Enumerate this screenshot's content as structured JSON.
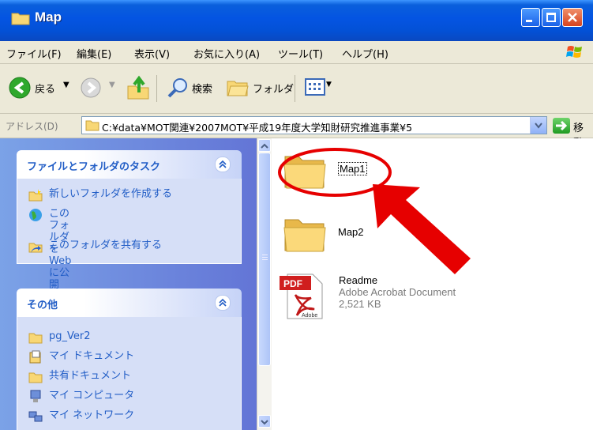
{
  "window": {
    "title": "Map"
  },
  "menu": {
    "items": [
      "ファイル(F)",
      "編集(E)",
      "表示(V)",
      "お気に入り(A)",
      "ツール(T)",
      "ヘルプ(H)"
    ]
  },
  "toolbar": {
    "back": "戻る",
    "search": "検索",
    "folders": "フォルダ"
  },
  "address": {
    "label": "アドレス(D)",
    "path": "C:¥data¥MOT関連¥2007MOT¥平成19年度大学知財研究推進事業¥5",
    "go": "移動"
  },
  "tasks_panel": {
    "title": "ファイルとフォルダのタスク",
    "items": [
      "新しいフォルダを作成する",
      "このフォルダを Web に公開\nする",
      "このフォルダを共有する"
    ]
  },
  "other_panel": {
    "title": "その他",
    "items": [
      "pg_Ver2",
      "マイ ドキュメント",
      "共有ドキュメント",
      "マイ コンピュータ",
      "マイ ネットワーク"
    ]
  },
  "files": [
    {
      "name": "Map1",
      "type": "folder"
    },
    {
      "name": "Map2",
      "type": "folder"
    },
    {
      "name": "Readme",
      "type": "pdf",
      "kind": "Adobe Acrobat Document",
      "size": "2,521 KB"
    }
  ],
  "colors": {
    "accent": "#215dc6",
    "titlebar": "#0454e2",
    "annotation": "#e60000"
  }
}
